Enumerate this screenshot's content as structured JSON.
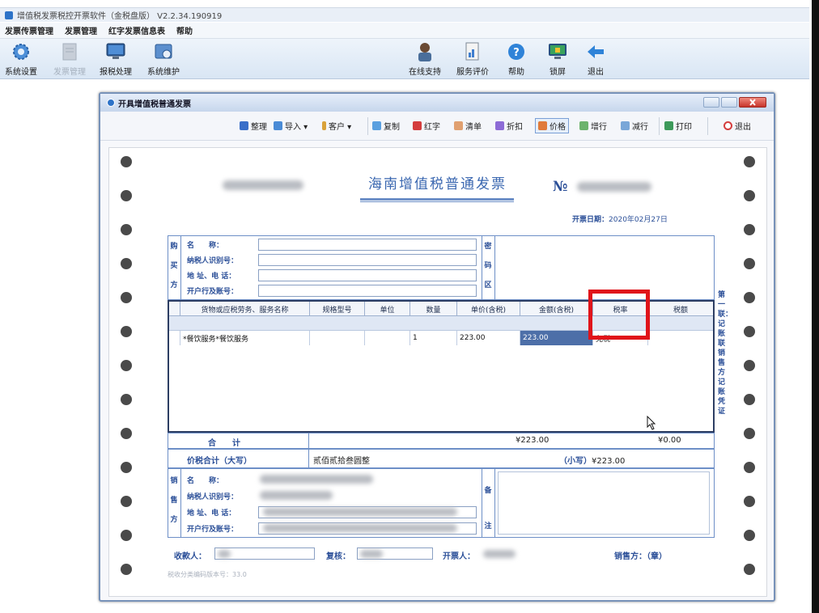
{
  "app": {
    "title": "增值税发票税控开票软件（金税盘版） V2.2.34.190919"
  },
  "menu": [
    "发票传票管理",
    "发票管理",
    "红字发票信息表",
    "帮助"
  ],
  "toolbar": {
    "left": [
      {
        "label": "系统设置",
        "icon": "gear-icon",
        "disabled": false
      },
      {
        "label": "发票管理",
        "icon": "invoice-icon",
        "disabled": true
      },
      {
        "label": "报税处理",
        "icon": "monitor-icon",
        "disabled": false
      },
      {
        "label": "系统维护",
        "icon": "maintenance-icon",
        "disabled": false
      }
    ],
    "right": [
      {
        "label": "在线支持",
        "icon": "support-person-icon"
      },
      {
        "label": "服务评价",
        "icon": "rating-icon"
      },
      {
        "label": "帮助",
        "icon": "help-icon"
      },
      {
        "label": "锁屏",
        "icon": "lock-screen-icon"
      },
      {
        "label": "退出",
        "icon": "exit-arrow-icon"
      }
    ]
  },
  "window": {
    "title": "开具增值税普通发票",
    "tools": [
      {
        "label": "整理",
        "color": "#3a6fc9"
      },
      {
        "label": "导入 ▾",
        "color": "#4a8bd6"
      },
      {
        "label": "客户 ▾",
        "color": "#d9a23a"
      },
      {
        "label": "复制",
        "color": "#5aa0e0"
      },
      {
        "label": "红字",
        "color": "#d43d3d"
      },
      {
        "label": "清单",
        "color": "#e0a070"
      },
      {
        "label": "折扣",
        "color": "#8d6bd6"
      },
      {
        "label": "价格",
        "color": "#e07a3a"
      },
      {
        "label": "增行",
        "color": "#6db36d"
      },
      {
        "label": "减行",
        "color": "#7aa7d8"
      },
      {
        "label": "打印",
        "color": "#3d9a5a"
      },
      {
        "label": "退出",
        "color": "#d43d3d"
      }
    ]
  },
  "invoice": {
    "title": "海南增值税普通发票",
    "no_label": "№",
    "date_label": "开票日期：",
    "date_value": "2020年02月27日",
    "buyer": {
      "side_label": [
        "购",
        "买",
        "方"
      ],
      "fields": [
        "名　　称：",
        "纳税人识别号：",
        "地 址、电 话：",
        "开户行及账号："
      ]
    },
    "password_side": [
      "密",
      "码",
      "区"
    ],
    "table": {
      "headers": [
        "货物或应税劳务、服务名称",
        "规格型号",
        "单位",
        "数量",
        "单价(含税)",
        "金额(含税)",
        "税率",
        "税额"
      ],
      "rows": [
        [
          "*餐饮服务*餐饮服务",
          "",
          "",
          "1",
          "223.00",
          "223.00",
          "免税",
          ""
        ]
      ]
    },
    "total_label": "合　　计",
    "total_amount": "¥223.00",
    "total_tax": "¥0.00",
    "jiashui_label": "价税合计（大写）",
    "jiashui_upper": "贰佰贰拾叁圆整",
    "jiashui_lower_label": "（小写）",
    "jiashui_lower": "¥223.00",
    "seller": {
      "side_label": [
        "销",
        "售",
        "方"
      ],
      "fields": [
        "名　　称：",
        "纳税人识别号：",
        "地 址、电 话：",
        "开户行及账号："
      ]
    },
    "remark_side": [
      "备",
      "注"
    ],
    "payee_label": "收款人：",
    "reviewer_label": "复核：",
    "issuer_label": "开票人：",
    "seller_stamp_label": "销售方：（章）",
    "side_note": "第一联：记账联　销售方记账凭证",
    "version_note": "税收分类编码版本号：33.0"
  }
}
